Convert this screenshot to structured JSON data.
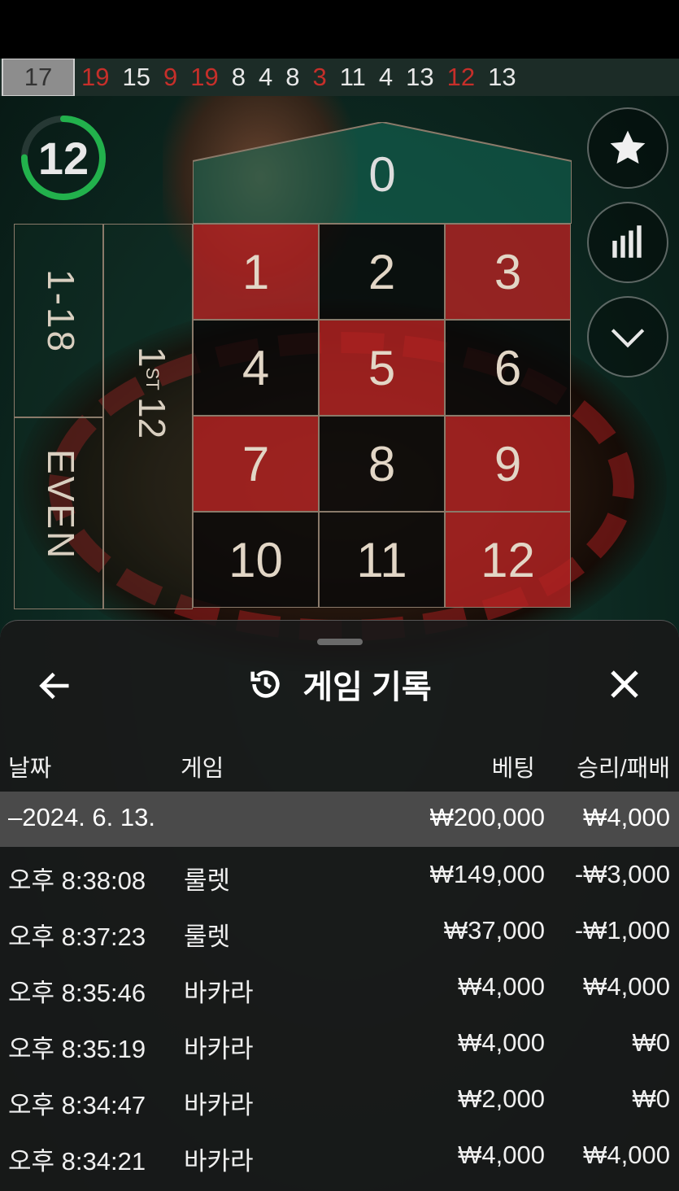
{
  "history": [
    {
      "n": "17",
      "color": "highlight"
    },
    {
      "n": "19",
      "color": "red"
    },
    {
      "n": "15",
      "color": "black"
    },
    {
      "n": "9",
      "color": "red"
    },
    {
      "n": "19",
      "color": "red"
    },
    {
      "n": "8",
      "color": "black"
    },
    {
      "n": "4",
      "color": "black"
    },
    {
      "n": "8",
      "color": "black"
    },
    {
      "n": "3",
      "color": "red"
    },
    {
      "n": "11",
      "color": "black"
    },
    {
      "n": "4",
      "color": "black"
    },
    {
      "n": "13",
      "color": "black"
    },
    {
      "n": "12",
      "color": "red"
    },
    {
      "n": "13",
      "color": "black"
    }
  ],
  "timer": {
    "value": "12",
    "progress": 0.75,
    "color": "#22b14c"
  },
  "table": {
    "zero": "0",
    "numbers": [
      {
        "n": "1",
        "color": "red"
      },
      {
        "n": "2",
        "color": "black"
      },
      {
        "n": "3",
        "color": "red"
      },
      {
        "n": "4",
        "color": "black"
      },
      {
        "n": "5",
        "color": "red"
      },
      {
        "n": "6",
        "color": "black"
      },
      {
        "n": "7",
        "color": "red"
      },
      {
        "n": "8",
        "color": "black"
      },
      {
        "n": "9",
        "color": "red"
      },
      {
        "n": "10",
        "color": "black"
      },
      {
        "n": "11",
        "color": "black"
      },
      {
        "n": "12",
        "color": "red"
      }
    ],
    "outside_low": "1-18",
    "outside_even": "EVEN",
    "dozen_first": "12",
    "dozen_first_sup": "ST",
    "dozen_first_pre": "1"
  },
  "side_buttons": [
    "star-icon",
    "statistics-icon",
    "chevron-down-icon"
  ],
  "panel": {
    "title": "게임 기록",
    "columns": {
      "date": "날짜",
      "game": "게임",
      "bet": "베팅",
      "winloss": "승리/패배"
    },
    "date_group": {
      "date": "–2024. 6. 13.",
      "bet": "₩200,000",
      "winloss": "₩4,000"
    },
    "rows": [
      {
        "time": "오후 8:38:08",
        "game": "룰렛",
        "bet": "₩149,000",
        "winloss": "-₩3,000"
      },
      {
        "time": "오후 8:37:23",
        "game": "룰렛",
        "bet": "₩37,000",
        "winloss": "-₩1,000"
      },
      {
        "time": "오후 8:35:46",
        "game": "바카라",
        "bet": "₩4,000",
        "winloss": "₩4,000"
      },
      {
        "time": "오후 8:35:19",
        "game": "바카라",
        "bet": "₩4,000",
        "winloss": "₩0"
      },
      {
        "time": "오후 8:34:47",
        "game": "바카라",
        "bet": "₩2,000",
        "winloss": "₩0"
      },
      {
        "time": "오후 8:34:21",
        "game": "바카라",
        "bet": "₩4,000",
        "winloss": "₩4,000"
      }
    ]
  }
}
